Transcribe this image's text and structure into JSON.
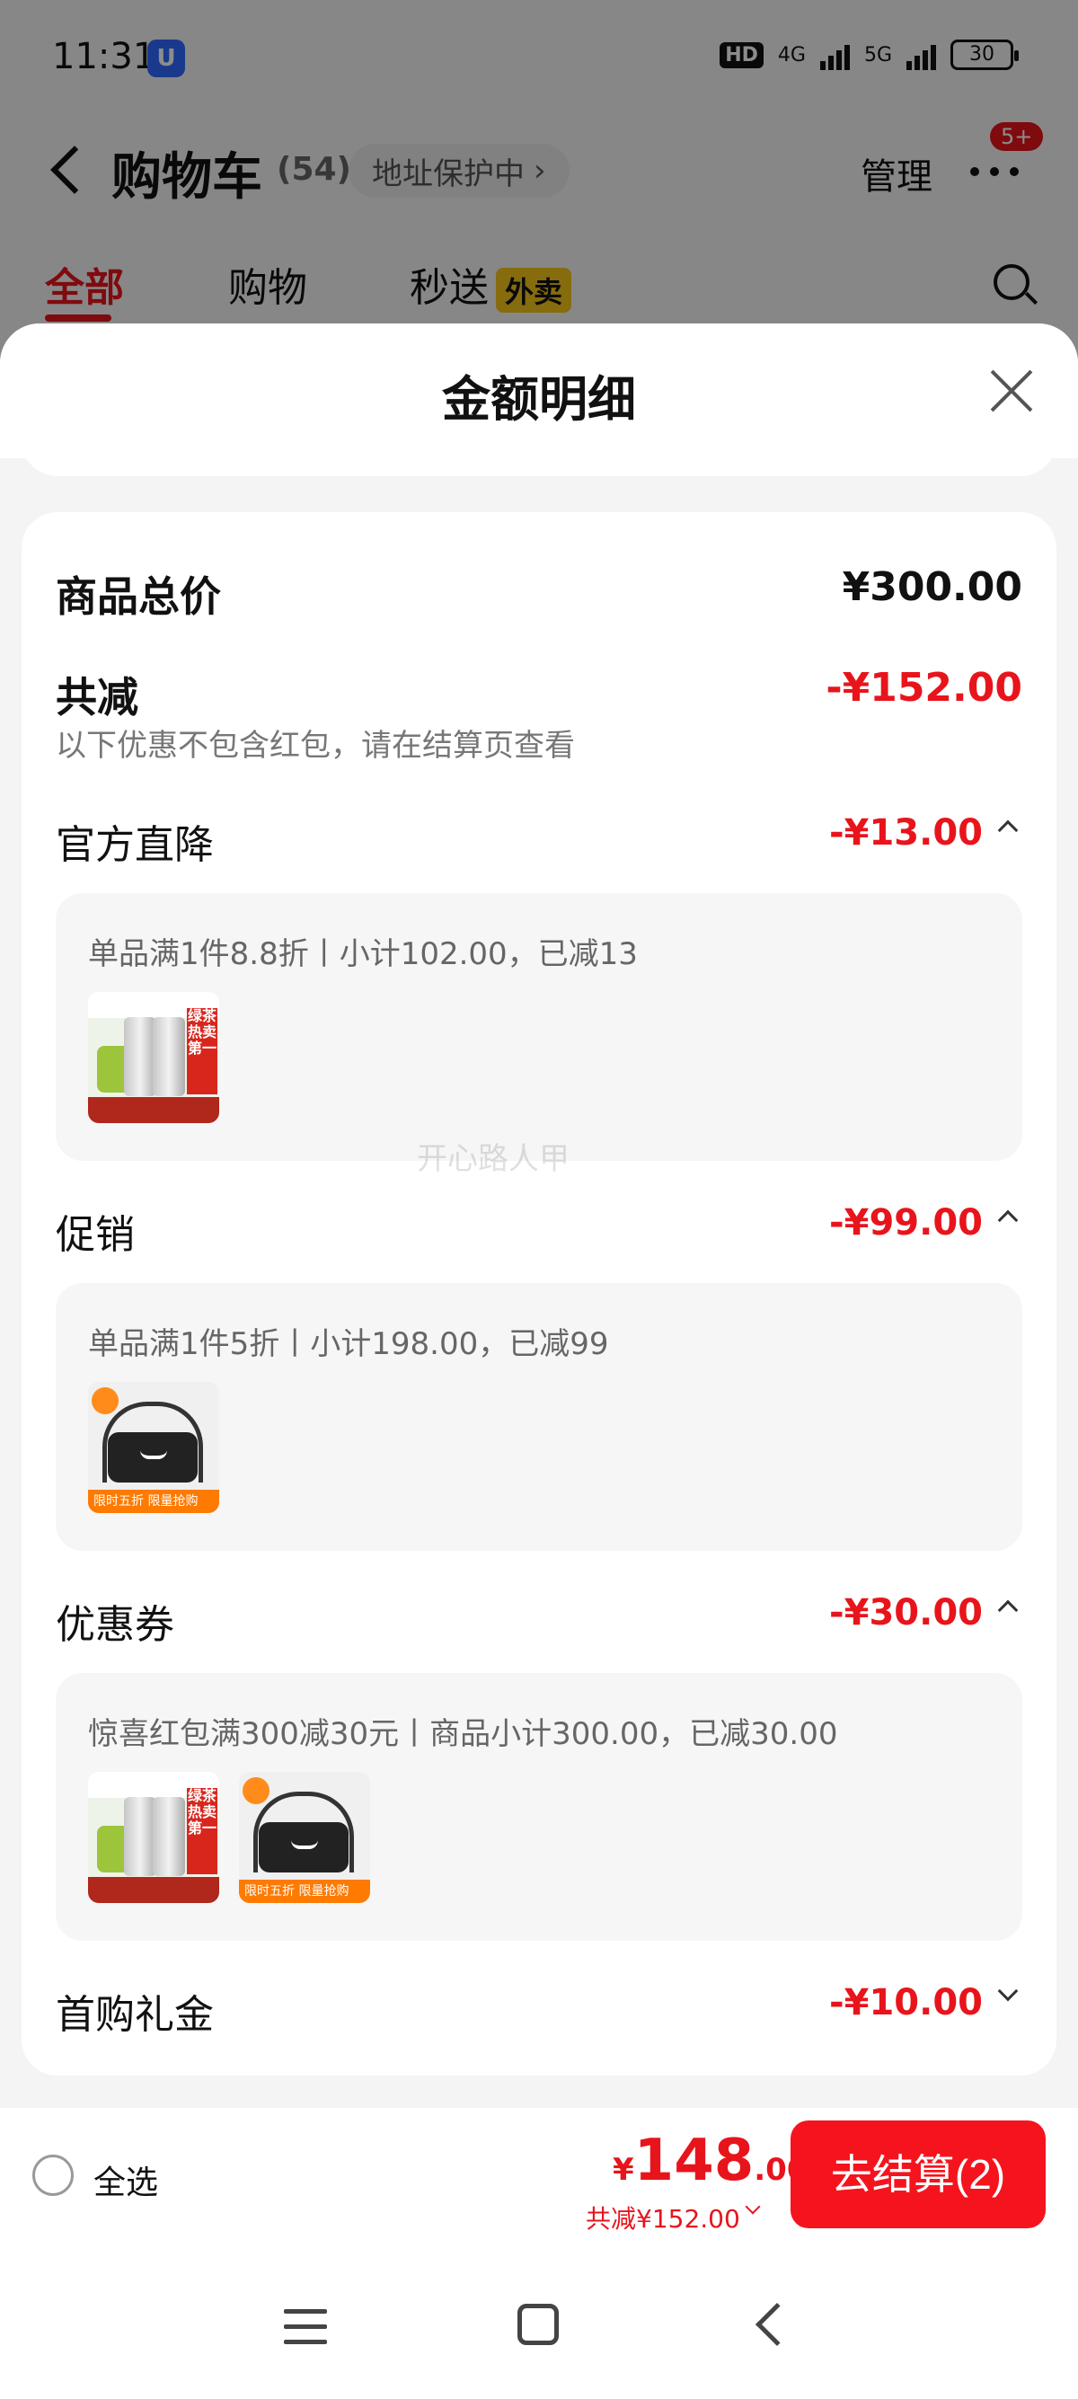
{
  "status_bar": {
    "time": "11:31",
    "app_icon": "U",
    "hd": "HD",
    "net1": "4G",
    "net2": "5G",
    "battery": "30"
  },
  "nav": {
    "title": "购物车",
    "count": "(54)",
    "address_protect": "地址保护中",
    "manage": "管理",
    "more_badge": "5+"
  },
  "tabs": [
    {
      "label": "全部"
    },
    {
      "label": "购物"
    },
    {
      "label": "秒送",
      "tag": "外卖"
    }
  ],
  "sheet": {
    "title": "金额明细",
    "goods_total_label": "商品总价",
    "goods_total_value": "¥300.00",
    "discount_label": "共减",
    "discount_value": "-¥152.00",
    "discount_note": "以下优惠不包含红包，请在结算页查看",
    "sections": [
      {
        "label": "官方直降",
        "amount": "-¥13.00",
        "detail": "单品满1件8.8折丨小计102.00，已减13",
        "expanded": true
      },
      {
        "label": "促销",
        "amount": "-¥99.00",
        "detail": "单品满1件5折丨小计198.00，已减99",
        "expanded": true
      },
      {
        "label": "优惠券",
        "amount": "-¥30.00",
        "detail": "惊喜红包满300减30元丨商品小计300.00，已减30.00",
        "expanded": true
      },
      {
        "label": "首购礼金",
        "amount": "-¥10.00",
        "expanded": false
      }
    ],
    "product_tag_tea": "绿茶热卖第一",
    "product_tag_bag": "限时五折 限量抢购",
    "watermark": "开心路人甲"
  },
  "checkout": {
    "select_all": "全选",
    "currency": "¥",
    "total_int": "148",
    "total_dec": ".00",
    "saved": "共减¥152.00",
    "button": "去结算(2)"
  },
  "colors": {
    "accent": "#e8141c",
    "tag_yellow": "#f5c518"
  }
}
